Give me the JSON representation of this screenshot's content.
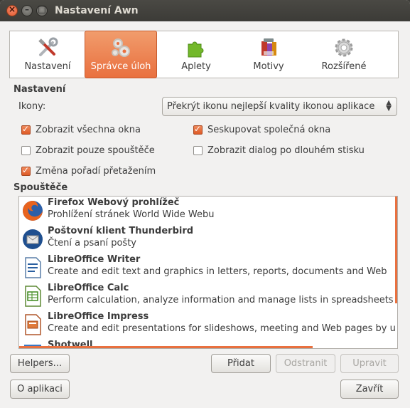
{
  "window": {
    "title": "Nastavení Awn"
  },
  "tabs": [
    {
      "label": "Nastavení",
      "icon": "tools-icon"
    },
    {
      "label": "Správce úloh",
      "icon": "gears-icon"
    },
    {
      "label": "Aplety",
      "icon": "puzzle-icon"
    },
    {
      "label": "Motivy",
      "icon": "themes-icon"
    },
    {
      "label": "Rozšířené",
      "icon": "gear-icon"
    }
  ],
  "active_tab": "Správce úloh",
  "settings": {
    "section_title": "Nastavení",
    "icons_label": "Ikony:",
    "icons_value": "Překrýt ikonu nejlepší kvality ikonou aplikace",
    "checkboxes": [
      {
        "label": "Zobrazit všechna okna",
        "checked": true
      },
      {
        "label": "Seskupovat společná okna",
        "checked": true
      },
      {
        "label": "Zobrazit pouze spouštěče",
        "checked": false
      },
      {
        "label": "Zobrazit dialog po dlouhém stisku",
        "checked": false
      },
      {
        "label": "Změna pořadí přetažením",
        "checked": true
      }
    ]
  },
  "launchers": {
    "section_title": "Spouštěče",
    "items": [
      {
        "name": "Firefox Webový prohlížeč",
        "desc": "Prohlížení stránek World Wide Webu",
        "icon": "firefox-icon"
      },
      {
        "name": "Poštovní klient Thunderbird",
        "desc": "Čtení a psaní pošty",
        "icon": "thunderbird-icon"
      },
      {
        "name": "LibreOffice Writer",
        "desc": "Create and edit text and graphics in letters, reports, documents and Web",
        "icon": "writer-icon"
      },
      {
        "name": "LibreOffice Calc",
        "desc": "Perform calculation, analyze information and manage lists in spreadsheets",
        "icon": "calc-icon"
      },
      {
        "name": "LibreOffice Impress",
        "desc": "Create and edit presentations for slideshows, meeting and Web pages by u",
        "icon": "impress-icon"
      },
      {
        "name": "Shotwell",
        "desc": "",
        "icon": "shotwell-icon"
      }
    ]
  },
  "buttons": {
    "helpers": "Helpers...",
    "add": "Přidat",
    "remove": "Odstranit",
    "edit": "Upravit",
    "about": "O aplikaci",
    "close": "Zavřít"
  },
  "colors": {
    "accent": "#e9703f",
    "titlebar": "#3c3b37"
  }
}
